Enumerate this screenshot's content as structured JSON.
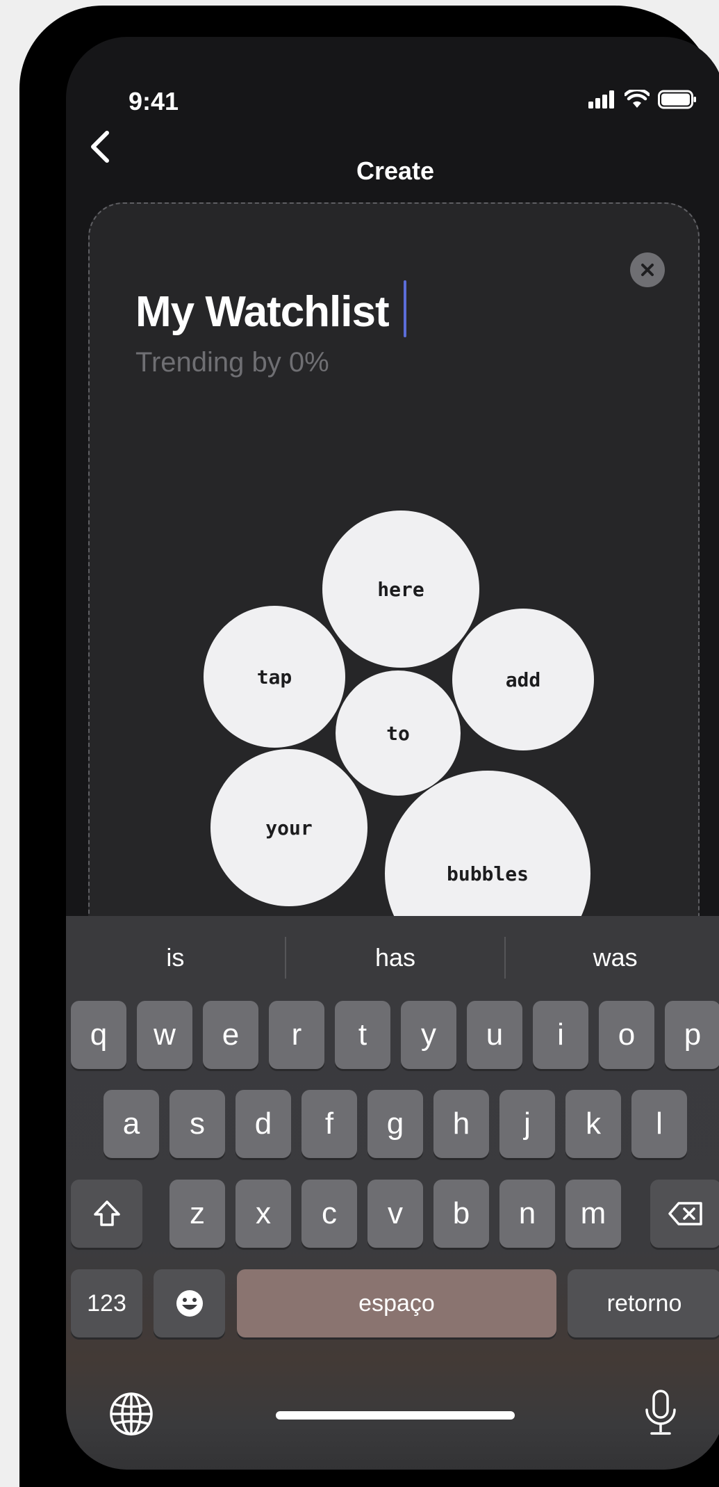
{
  "status_bar": {
    "time": "9:41"
  },
  "nav": {
    "title": "Create"
  },
  "card": {
    "title": "My Watchlist",
    "subtitle": "Trending by 0%"
  },
  "bubbles": [
    {
      "label": "here"
    },
    {
      "label": "tap"
    },
    {
      "label": "add"
    },
    {
      "label": "to"
    },
    {
      "label": "your"
    },
    {
      "label": "bubbles"
    }
  ],
  "keyboard": {
    "suggestions": [
      "is",
      "has",
      "was"
    ],
    "row1": [
      "q",
      "w",
      "e",
      "r",
      "t",
      "y",
      "u",
      "i",
      "o",
      "p"
    ],
    "row2": [
      "a",
      "s",
      "d",
      "f",
      "g",
      "h",
      "j",
      "k",
      "l"
    ],
    "row3": [
      "z",
      "x",
      "c",
      "v",
      "b",
      "n",
      "m"
    ],
    "numbers_label": "123",
    "space_label": "espaço",
    "return_label": "retorno"
  },
  "icons": [
    "back-chevron-icon",
    "signal-icon",
    "wifi-icon",
    "battery-icon",
    "close-icon",
    "shift-icon",
    "delete-icon",
    "emoji-icon",
    "globe-icon",
    "microphone-icon"
  ]
}
